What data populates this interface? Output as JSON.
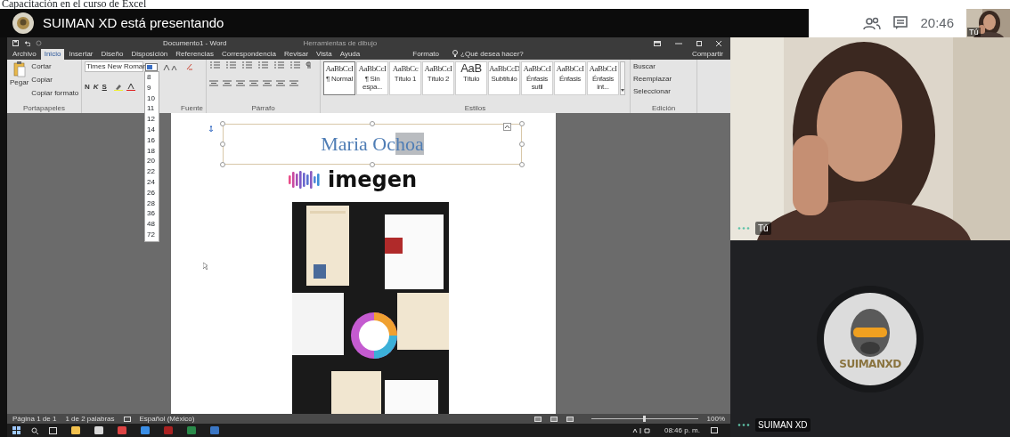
{
  "caption": "Capacitación en el curso de Excel",
  "meet": {
    "banner": "SUIMAN XD está presentando",
    "clock": "20:46",
    "self_label": "Tú"
  },
  "word": {
    "title": "Documento1 - Word",
    "context_header": "Herramientas de dibujo",
    "tabs": [
      {
        "label": "Archivo",
        "selected": false
      },
      {
        "label": "Inicio",
        "selected": true
      },
      {
        "label": "Insertar",
        "selected": false
      },
      {
        "label": "Diseño",
        "selected": false
      },
      {
        "label": "Disposición",
        "selected": false
      },
      {
        "label": "Referencias",
        "selected": false
      },
      {
        "label": "Correspondencia",
        "selected": false
      },
      {
        "label": "Revisar",
        "selected": false
      },
      {
        "label": "Vista",
        "selected": false
      },
      {
        "label": "Ayuda",
        "selected": false
      },
      {
        "label": "Formato",
        "selected": false
      }
    ],
    "tell_me": "¿Qué desea hacer?",
    "share": "Compartir",
    "clipboard": {
      "paste": "Pegar",
      "items": [
        "Cortar",
        "Copiar",
        "Copiar formato"
      ],
      "group": "Portapapeles"
    },
    "font": {
      "name": "Times New Roman",
      "format_buttons": [
        "N",
        "K",
        "S"
      ],
      "group": "Fuente"
    },
    "paragraph": {
      "group": "Párrafo"
    },
    "size_list": {
      "expanded": true,
      "items": [
        "8",
        "9",
        "10",
        "11",
        "12",
        "14",
        "16",
        "18",
        "20",
        "22",
        "24",
        "26",
        "28",
        "36",
        "48",
        "72"
      ]
    },
    "styles": {
      "group": "Estilos",
      "items": [
        {
          "sample": "AaBbCcI",
          "name": "¶ Normal",
          "selected": true
        },
        {
          "sample": "AaBbCcI",
          "name": "¶ Sin espa...",
          "selected": false
        },
        {
          "sample": "AaBbCc",
          "name": "Título 1",
          "selected": false
        },
        {
          "sample": "AaBbCcI",
          "name": "Título 2",
          "selected": false
        },
        {
          "sample": "AaB",
          "name": "Título",
          "selected": false
        },
        {
          "sample": "AaBbCcD",
          "name": "Subtítulo",
          "selected": false
        },
        {
          "sample": "AaBbCcI",
          "name": "Énfasis sutil",
          "selected": false
        },
        {
          "sample": "AaBbCcI",
          "name": "Énfasis",
          "selected": false
        },
        {
          "sample": "AaBbCcI",
          "name": "Énfasis int...",
          "selected": false
        }
      ]
    },
    "editing": {
      "group": "Edición",
      "items": [
        "Buscar",
        "Reemplazar",
        "Seleccionar"
      ]
    },
    "document": {
      "title_parts": [
        {
          "text": "Maria Oc",
          "selected": false
        },
        {
          "text": "hoa",
          "selected": true
        }
      ],
      "logo_text": "imegen"
    },
    "status": {
      "page": "Página 1 de 1",
      "words": "1 de 2 palabras",
      "language": "Español (México)",
      "zoom": "100%",
      "zoom_slider": {
        "level": 0.5
      }
    },
    "taskbar": {
      "time": "08:46 p. m."
    }
  },
  "tiles": [
    {
      "kind": "video",
      "name": "Tú"
    },
    {
      "kind": "avatar",
      "name": "SUIMAN XD",
      "avatar_text": "SUIMANXD"
    }
  ]
}
